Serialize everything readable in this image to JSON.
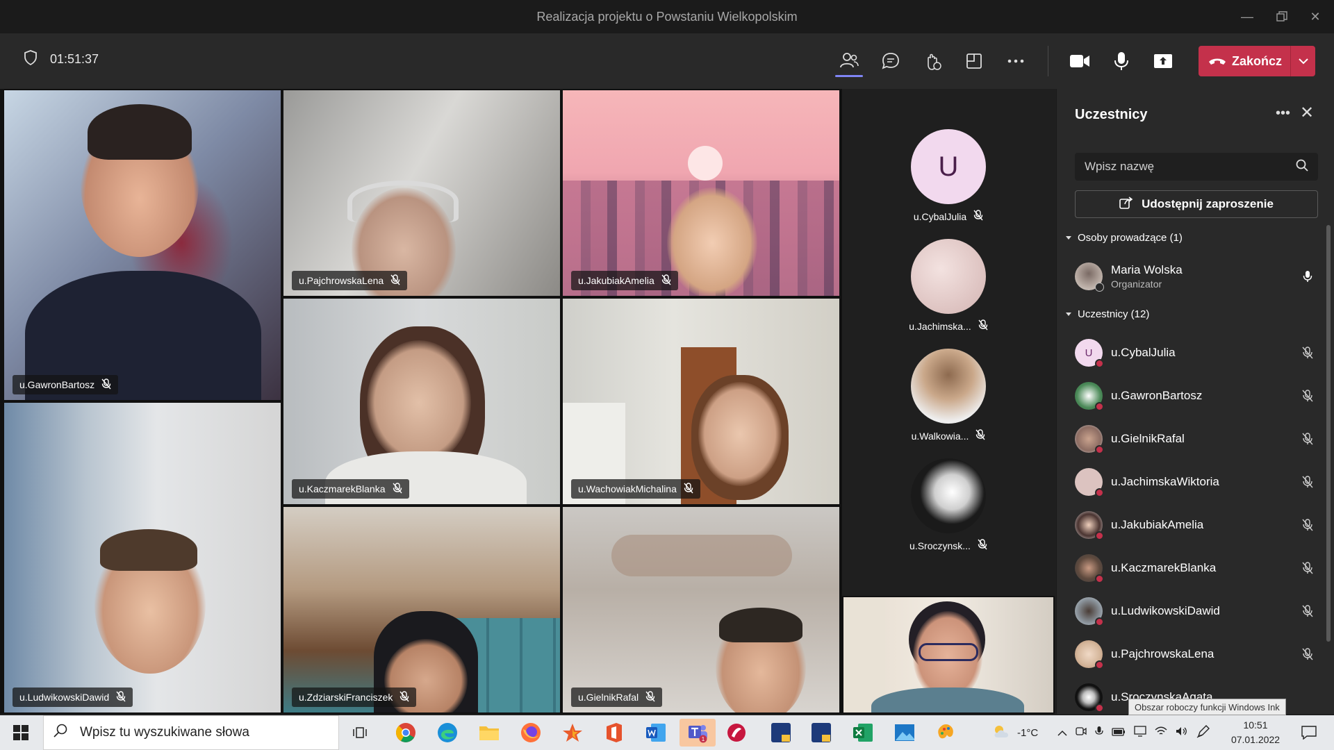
{
  "window": {
    "title": "Realizacja projektu o Powstaniu Wielkopolskim"
  },
  "toolbar": {
    "timer": "01:51:37",
    "end_label": "Zakończ",
    "icons": [
      "people-icon",
      "chat-icon",
      "reactions-icon",
      "rooms-icon",
      "more-icon",
      "camera-icon",
      "mic-icon",
      "share-icon"
    ]
  },
  "tiles": [
    {
      "name": "u.GawronBartosz",
      "muted": true
    },
    {
      "name": "u.PajchrowskaLena",
      "muted": true
    },
    {
      "name": "u.JakubiakAmelia",
      "muted": true
    },
    {
      "name": "u.KaczmarekBlanka",
      "muted": true
    },
    {
      "name": "u.WachowiakMichalina",
      "muted": true
    },
    {
      "name": "u.LudwikowskiDawid",
      "muted": true
    },
    {
      "name": "u.ZdziarskiFranciszek",
      "muted": true
    },
    {
      "name": "u.GielnikRafal",
      "muted": true
    }
  ],
  "rail": [
    {
      "name": "u.CybalJulia",
      "initial": "U"
    },
    {
      "name": "u.Jachimska..."
    },
    {
      "name": "u.Walkowia..."
    },
    {
      "name": "u.Sroczynsk..."
    }
  ],
  "panel": {
    "title": "Uczestnicy",
    "search_placeholder": "Wpisz nazwę",
    "share_label": "Udostępnij zaproszenie",
    "presenters_header": "Osoby prowadzące (1)",
    "organizer": {
      "name": "Maria Wolska",
      "role": "Organizator"
    },
    "attendees_header": "Uczestnicy (12)",
    "attendees": [
      {
        "name": "u.CybalJulia",
        "initial": "U"
      },
      {
        "name": "u.GawronBartosz"
      },
      {
        "name": "u.GielnikRafal"
      },
      {
        "name": "u.JachimskaWiktoria"
      },
      {
        "name": "u.JakubiakAmelia"
      },
      {
        "name": "u.KaczmarekBlanka"
      },
      {
        "name": "u.LudwikowskiDawid"
      },
      {
        "name": "u.PajchrowskaLena"
      },
      {
        "name": "u.SroczynskaAgata"
      }
    ]
  },
  "tooltip": "Obszar roboczy funkcji Windows Ink",
  "taskbar": {
    "search_placeholder": "Wpisz tu wyszukiwane słowa",
    "weather": "-1°C",
    "time": "10:51",
    "date": "07.01.2022"
  },
  "colors": {
    "end_call": "#c4314b",
    "accent": "#7f85f5",
    "muted_dot": "#c4314b"
  }
}
